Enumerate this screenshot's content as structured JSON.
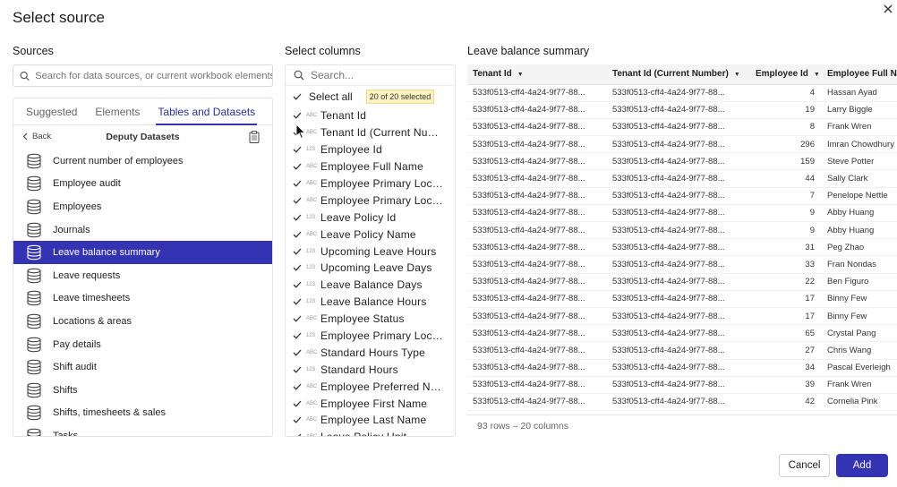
{
  "dialog": {
    "title": "Select source"
  },
  "sources": {
    "section_title": "Sources",
    "search_placeholder": "Search for data sources, or current workbook elements",
    "tabs": [
      {
        "label": "Suggested",
        "active": false
      },
      {
        "label": "Elements",
        "active": false
      },
      {
        "label": "Tables and Datasets",
        "active": true
      }
    ],
    "back_label": "Back",
    "folder_title": "Deputy Datasets",
    "items": [
      {
        "label": "Current number of employees",
        "selected": false
      },
      {
        "label": "Employee audit",
        "selected": false
      },
      {
        "label": "Employees",
        "selected": false
      },
      {
        "label": "Journals",
        "selected": false
      },
      {
        "label": "Leave balance summary",
        "selected": true
      },
      {
        "label": "Leave requests",
        "selected": false
      },
      {
        "label": "Leave timesheets",
        "selected": false
      },
      {
        "label": "Locations & areas",
        "selected": false
      },
      {
        "label": "Pay details",
        "selected": false
      },
      {
        "label": "Shift audit",
        "selected": false
      },
      {
        "label": "Shifts",
        "selected": false
      },
      {
        "label": "Shifts, timesheets & sales",
        "selected": false
      },
      {
        "label": "Tasks",
        "selected": false
      }
    ]
  },
  "columns": {
    "section_title": "Select columns",
    "search_placeholder": "Search...",
    "select_all_label": "Select all",
    "selected_badge": "20 of 20 selected",
    "items": [
      {
        "type": "ABC",
        "name": "Tenant Id"
      },
      {
        "type": "ABC",
        "name": "Tenant Id (Current Number)"
      },
      {
        "type": "123",
        "name": "Employee Id"
      },
      {
        "type": "ABC",
        "name": "Employee Full Name"
      },
      {
        "type": "ABC",
        "name": "Employee Primary Location"
      },
      {
        "type": "ABC",
        "name": "Employee Primary Location"
      },
      {
        "type": "123",
        "name": "Leave Policy Id"
      },
      {
        "type": "ABC",
        "name": "Leave Policy Name"
      },
      {
        "type": "123",
        "name": "Upcoming Leave Hours"
      },
      {
        "type": "123",
        "name": "Upcoming Leave Days"
      },
      {
        "type": "123",
        "name": "Leave Balance Days"
      },
      {
        "type": "123",
        "name": "Leave Balance Hours"
      },
      {
        "type": "ABC",
        "name": "Employee Status"
      },
      {
        "type": "123",
        "name": "Employee Primary Location"
      },
      {
        "type": "ABC",
        "name": "Standard Hours Type"
      },
      {
        "type": "123",
        "name": "Standard Hours"
      },
      {
        "type": "ABC",
        "name": "Employee Preferred Name"
      },
      {
        "type": "ABC",
        "name": "Employee First Name"
      },
      {
        "type": "ABC",
        "name": "Employee Last Name"
      },
      {
        "type": "ABC",
        "name": "Leave Policy Unit"
      }
    ]
  },
  "preview": {
    "section_title": "Leave balance summary",
    "headers": [
      "Tenant Id",
      "Tenant Id (Current Number)",
      "Employee Id",
      "Employee Full Name"
    ],
    "rows": [
      [
        "533f0513-cff4-4a24-9f77-88...",
        "533f0513-cff4-4a24-9f77-88...",
        "4",
        "Hassan Ayad"
      ],
      [
        "533f0513-cff4-4a24-9f77-88...",
        "533f0513-cff4-4a24-9f77-88...",
        "19",
        "Larry Biggle"
      ],
      [
        "533f0513-cff4-4a24-9f77-88...",
        "533f0513-cff4-4a24-9f77-88...",
        "8",
        "Frank Wren"
      ],
      [
        "533f0513-cff4-4a24-9f77-88...",
        "533f0513-cff4-4a24-9f77-88...",
        "296",
        "Imran Chowdhury"
      ],
      [
        "533f0513-cff4-4a24-9f77-88...",
        "533f0513-cff4-4a24-9f77-88...",
        "159",
        "Steve Potter"
      ],
      [
        "533f0513-cff4-4a24-9f77-88...",
        "533f0513-cff4-4a24-9f77-88...",
        "44",
        "Sally Clark"
      ],
      [
        "533f0513-cff4-4a24-9f77-88...",
        "533f0513-cff4-4a24-9f77-88...",
        "7",
        "Penelope Nettle"
      ],
      [
        "533f0513-cff4-4a24-9f77-88...",
        "533f0513-cff4-4a24-9f77-88...",
        "9",
        "Abby Huang"
      ],
      [
        "533f0513-cff4-4a24-9f77-88...",
        "533f0513-cff4-4a24-9f77-88...",
        "9",
        "Abby Huang"
      ],
      [
        "533f0513-cff4-4a24-9f77-88...",
        "533f0513-cff4-4a24-9f77-88...",
        "31",
        "Peg Zhao"
      ],
      [
        "533f0513-cff4-4a24-9f77-88...",
        "533f0513-cff4-4a24-9f77-88...",
        "33",
        "Fran Nondas"
      ],
      [
        "533f0513-cff4-4a24-9f77-88...",
        "533f0513-cff4-4a24-9f77-88...",
        "22",
        "Ben Figuro"
      ],
      [
        "533f0513-cff4-4a24-9f77-88...",
        "533f0513-cff4-4a24-9f77-88...",
        "17",
        "Binny Few"
      ],
      [
        "533f0513-cff4-4a24-9f77-88...",
        "533f0513-cff4-4a24-9f77-88...",
        "17",
        "Binny Few"
      ],
      [
        "533f0513-cff4-4a24-9f77-88...",
        "533f0513-cff4-4a24-9f77-88...",
        "65",
        "Crystal Pang"
      ],
      [
        "533f0513-cff4-4a24-9f77-88...",
        "533f0513-cff4-4a24-9f77-88...",
        "27",
        "Chris Wang"
      ],
      [
        "533f0513-cff4-4a24-9f77-88...",
        "533f0513-cff4-4a24-9f77-88...",
        "34",
        "Pascal Everleigh"
      ],
      [
        "533f0513-cff4-4a24-9f77-88...",
        "533f0513-cff4-4a24-9f77-88...",
        "39",
        "Frank Wren"
      ],
      [
        "533f0513-cff4-4a24-9f77-88...",
        "533f0513-cff4-4a24-9f77-88...",
        "42",
        "Cornelia Pink"
      ]
    ],
    "footer": "93 rows – 20 columns"
  },
  "actions": {
    "cancel_label": "Cancel",
    "add_label": "Add"
  },
  "colors": {
    "accent": "#3433b3",
    "badge_bg": "#fbf3c2"
  }
}
